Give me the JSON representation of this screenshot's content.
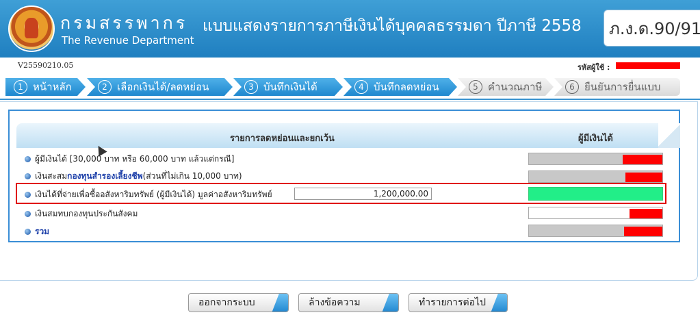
{
  "header": {
    "org_thai": "กรมสรรพากร",
    "org_english": "The Revenue Department",
    "form_title": "แบบแสดงรายการภาษีเงินได้บุคคลธรรมดา ปีภาษี 2558",
    "form_code": "ภ.ง.ด.90/91"
  },
  "version": "V25590210.05",
  "user_label": "รหัสผู้ใช้ :",
  "steps": [
    {
      "num": "1",
      "label": "หน้าหลัก",
      "active": true
    },
    {
      "num": "2",
      "label": "เลือกเงินได้/ลดหย่อน",
      "active": true
    },
    {
      "num": "3",
      "label": "บันทึกเงินได้",
      "active": true
    },
    {
      "num": "4",
      "label": "บันทึกลดหย่อน",
      "active": true
    },
    {
      "num": "5",
      "label": "คำนวณภาษี",
      "active": false
    },
    {
      "num": "6",
      "label": "ยืนยันการยื่นแบบ",
      "active": false
    }
  ],
  "table": {
    "col1": "รายการลดหย่อนและยกเว้น",
    "col2": "ผู้มีเงินได้",
    "rows": [
      {
        "pre": "ผู้มีเงินได้ [30,000 บาท หรือ 60,000 บาท แล้วแต่กรณี]",
        "link": "",
        "post": ""
      },
      {
        "pre": "เงินสะสม ",
        "link": "กองทุนสำรองเลี้ยงชีพ",
        "post": " (ส่วนที่ไม่เกิน 10,000 บาท)"
      },
      {
        "pre": "เงินได้ที่จ่ายเพื่อซื้ออสังหาริมทรัพย์ (ผู้มีเงินได้) มูลค่าอสังหาริมทรัพย์",
        "link": "",
        "post": ""
      },
      {
        "pre": "เงินสมทบกองทุนประกันสังคม",
        "link": "",
        "post": ""
      },
      {
        "pre": "",
        "link": "รวม",
        "post": ""
      }
    ],
    "property_value": "1,200,000.00"
  },
  "buttons": {
    "logout": "ออกจากระบบ",
    "clear": "ล้างข้อความ",
    "next": "ทำรายการต่อไป"
  },
  "colors": {
    "header_blue": "#2a8fd0",
    "active_step": "#1f88cf",
    "highlight_red": "#e00000",
    "filled_green": "#22ee88"
  }
}
